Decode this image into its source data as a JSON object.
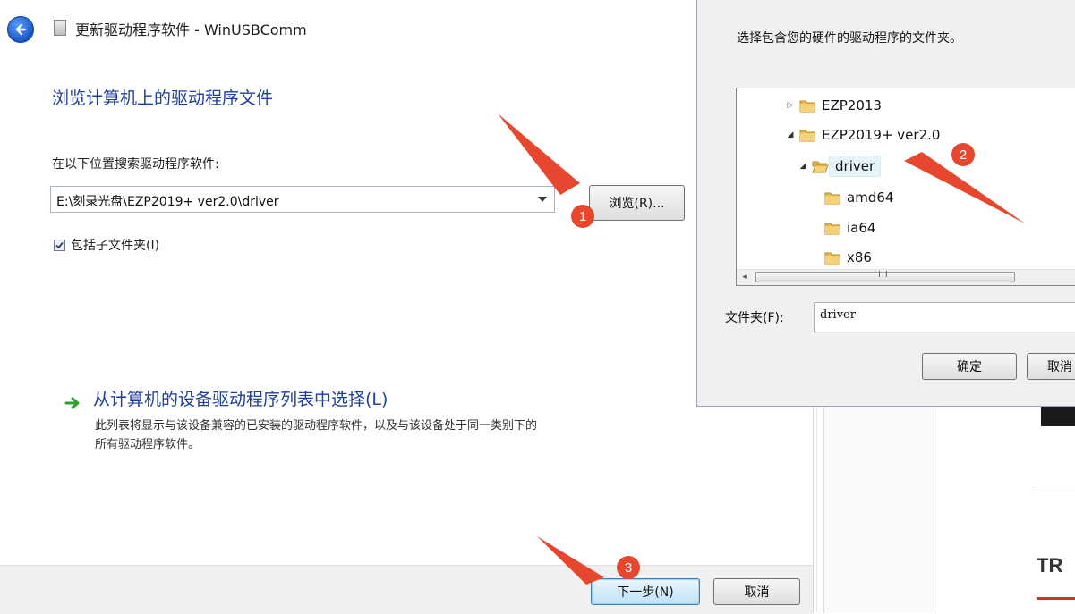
{
  "wizard": {
    "title": "更新驱动程序软件 - WinUSBComm",
    "heading": "浏览计算机上的驱动程序文件",
    "search_label": "在以下位置搜索驱动程序软件:",
    "path_value": "E:\\刻录光盘\\EZP2019+ ver2.0\\driver",
    "browse_label": "浏览(R)...",
    "include_subfolders_label": "包括子文件夹(I)",
    "include_subfolders_checked": true,
    "pick_title": "从计算机的设备驱动程序列表中选择(L)",
    "pick_desc_line1": "此列表将显示与该设备兼容的已安装的驱动程序软件，以及与该设备处于同一类别下的",
    "pick_desc_line2": "所有驱动程序软件。",
    "next_label": "下一步(N)",
    "cancel_label": "取消"
  },
  "browse_dialog": {
    "description": "选择包含您的硬件的驱动程序的文件夹。",
    "tree": [
      {
        "name": "EZP2013",
        "expander": "▷"
      },
      {
        "name": "EZP2019+ ver2.0",
        "expander": "◢"
      },
      {
        "name": "driver",
        "expander": "◢",
        "selected": true
      },
      {
        "name": "amd64",
        "expander": ""
      },
      {
        "name": "ia64",
        "expander": ""
      },
      {
        "name": "x86",
        "expander": ""
      }
    ],
    "scroll_left": "◂",
    "scroll_grip": "III",
    "folder_label": "文件夹(F):",
    "folder_value": "driver",
    "ok_label": "确定",
    "cancel_label": "取消"
  },
  "background": {
    "partial_text": "TR"
  },
  "annotations": {
    "steps": [
      "1",
      "2",
      "3"
    ],
    "color": "#e8472f"
  }
}
